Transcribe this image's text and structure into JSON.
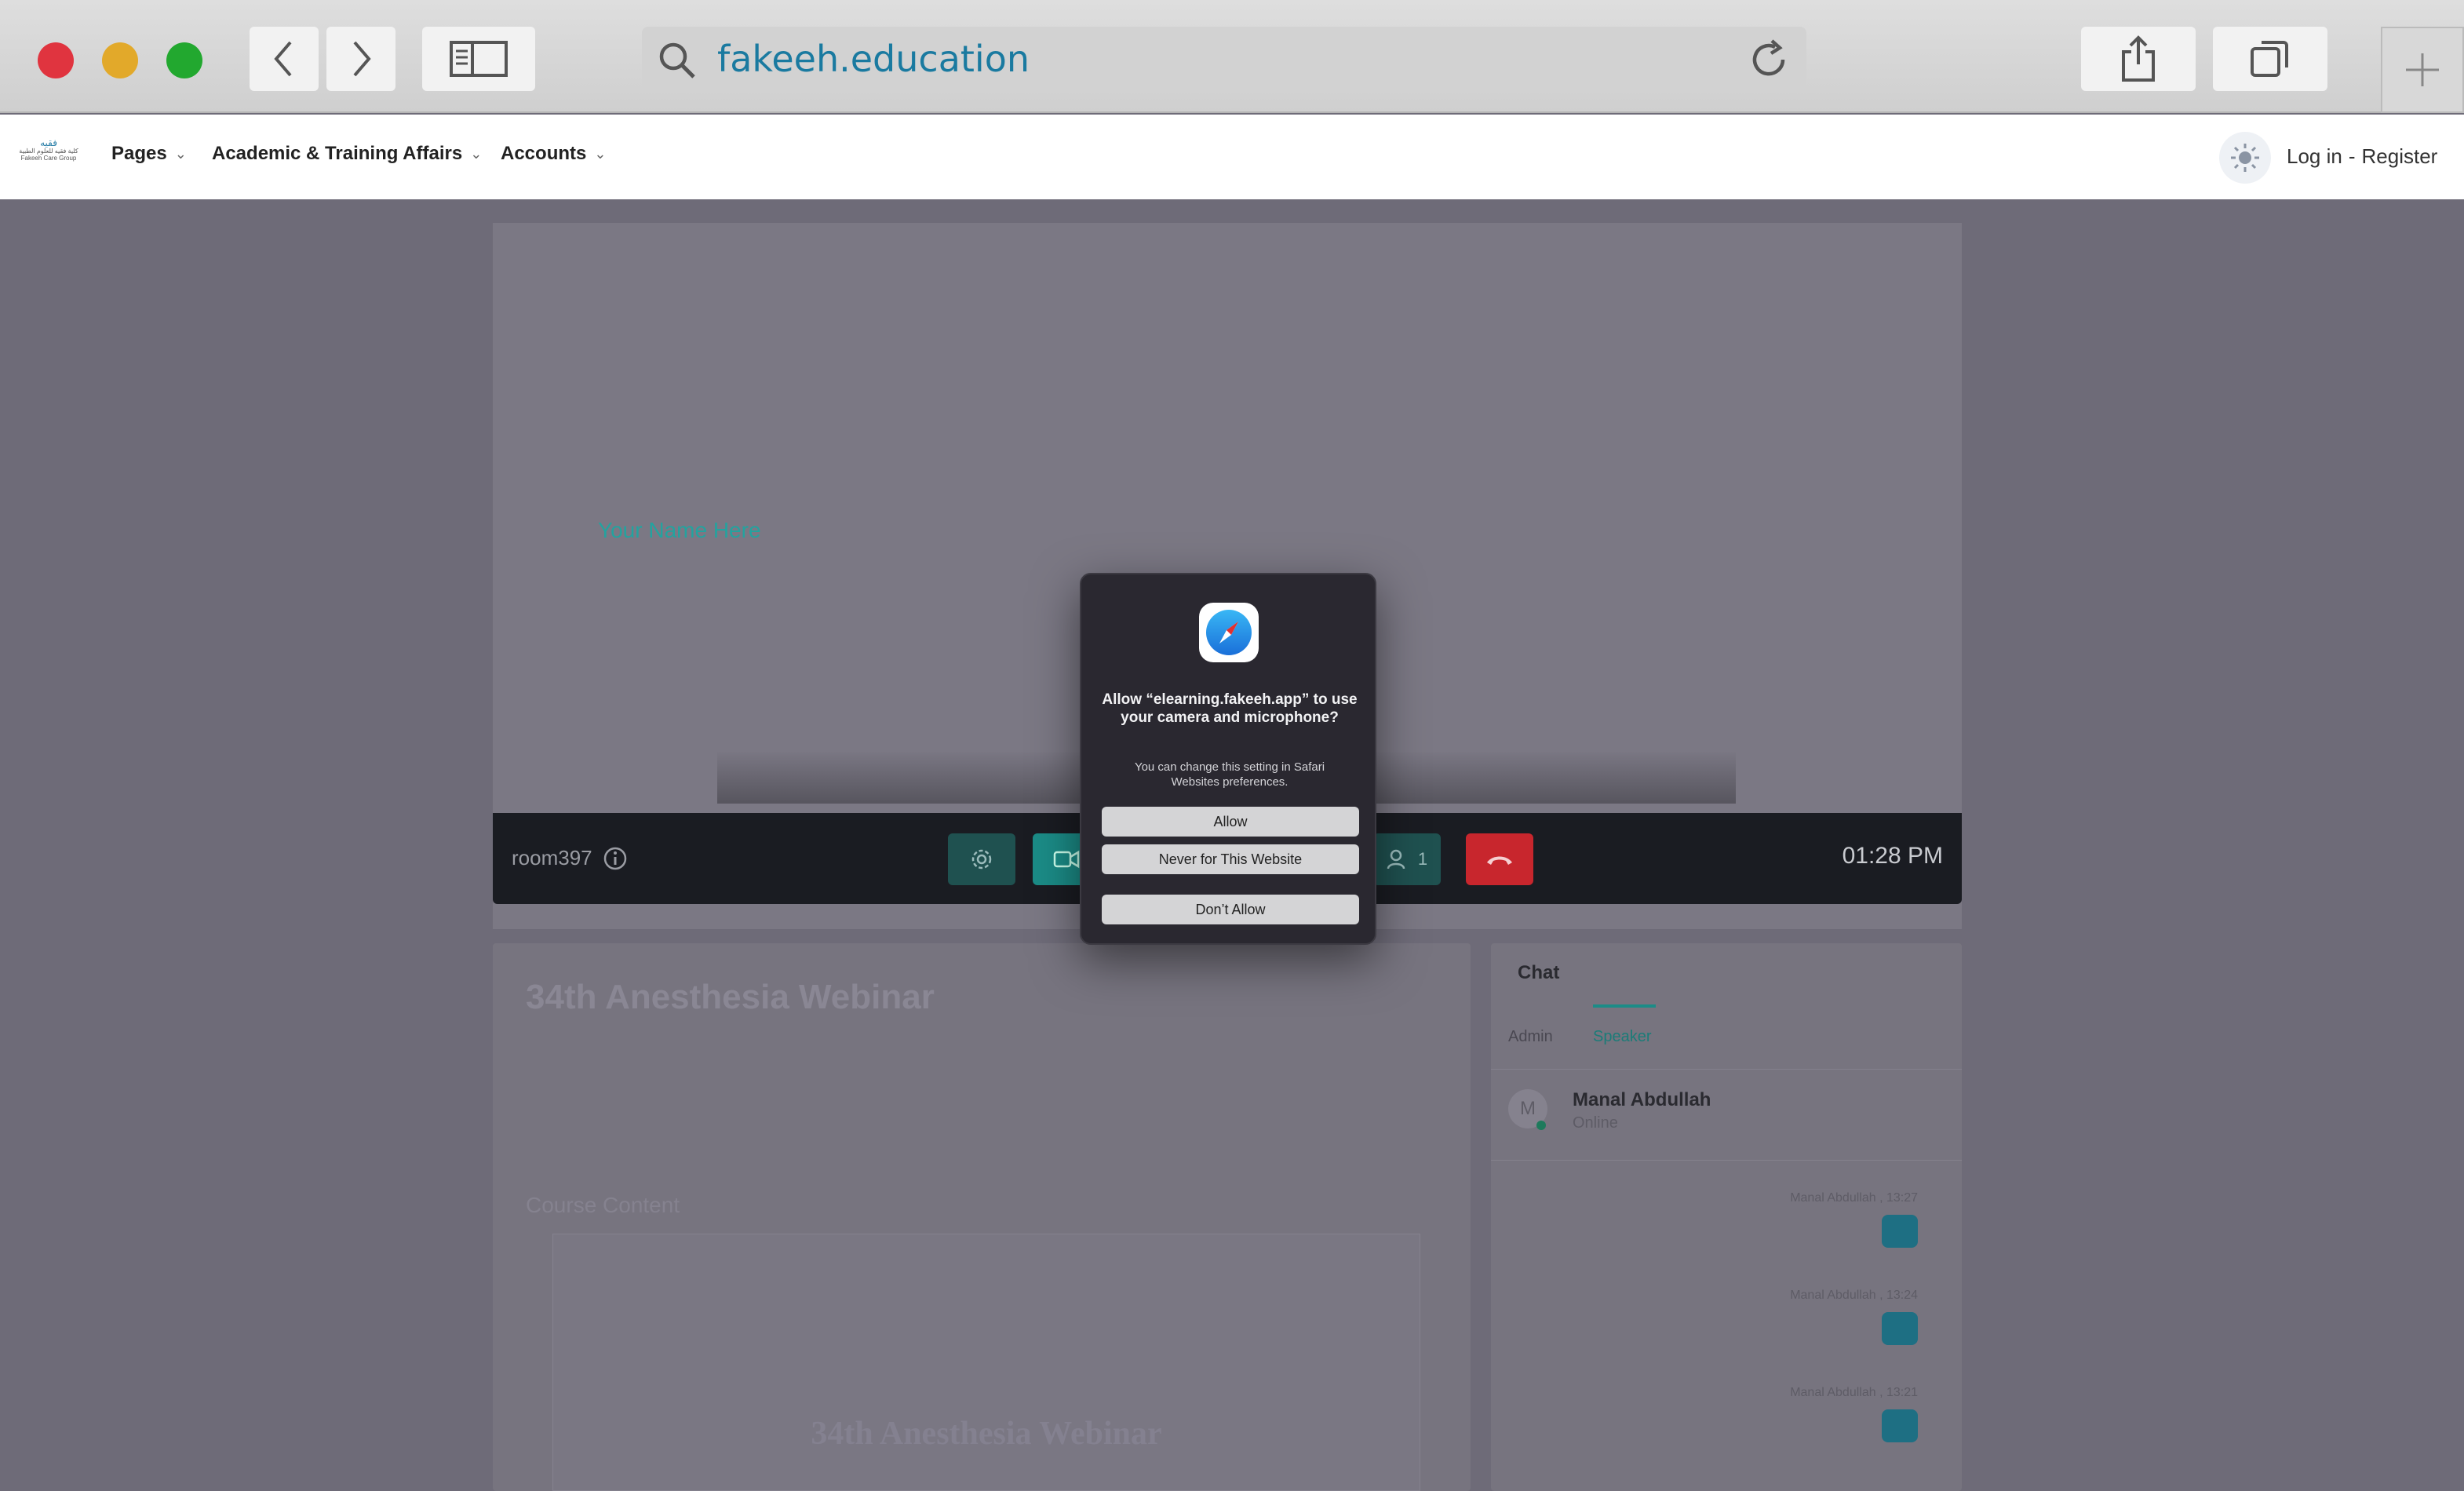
{
  "browser": {
    "url": "fakeeh.education",
    "traffic_lights": {
      "close": "#e0343f",
      "minimize": "#e2a92a",
      "zoom": "#22a82f"
    },
    "icons": [
      "back-icon",
      "forward-icon",
      "sidebar-icon",
      "search-icon",
      "reload-icon",
      "share-icon",
      "tabs-icon",
      "new-tab-icon"
    ]
  },
  "site_nav": {
    "logo_line1": "فقيه",
    "logo_line2": "كلية فقيه للعلوم الطبية",
    "logo_line3": "Fakeeh Care Group",
    "items": [
      {
        "label": "Pages"
      },
      {
        "label": "Academic & Training Affairs"
      },
      {
        "label": "Accounts"
      }
    ],
    "login": "Log in",
    "separator": "-",
    "register": "Register"
  },
  "video": {
    "name_overlay": "Your Name Here",
    "room": "room397",
    "participants_count": "1",
    "time": "01:28 PM",
    "accent": "#1b8c87",
    "hangup_color": "#c8262d"
  },
  "course": {
    "title": "34th Anesthesia Webinar",
    "content_heading": "Course Content",
    "slide_title": "34th Anesthesia Webinar"
  },
  "chat": {
    "title": "Chat",
    "tabs": [
      {
        "label": "Admin"
      },
      {
        "label": "Speaker"
      }
    ],
    "user_name": "Manal Abdullah",
    "user_status": "Online",
    "avatar_initial": "M",
    "messages": [
      {
        "meta": "Manal Abdullah , 13:27"
      },
      {
        "meta": "Manal Abdullah , 13:24"
      },
      {
        "meta": "Manal Abdullah , 13:21"
      }
    ]
  },
  "permission_dialog": {
    "title": "Allow “elearning.fakeeh.app” to use your camera and microphone?",
    "subtitle": "You can change this setting in Safari Websites preferences.",
    "allow": "Allow",
    "never": "Never for This Website",
    "dont_allow": "Don’t Allow"
  }
}
